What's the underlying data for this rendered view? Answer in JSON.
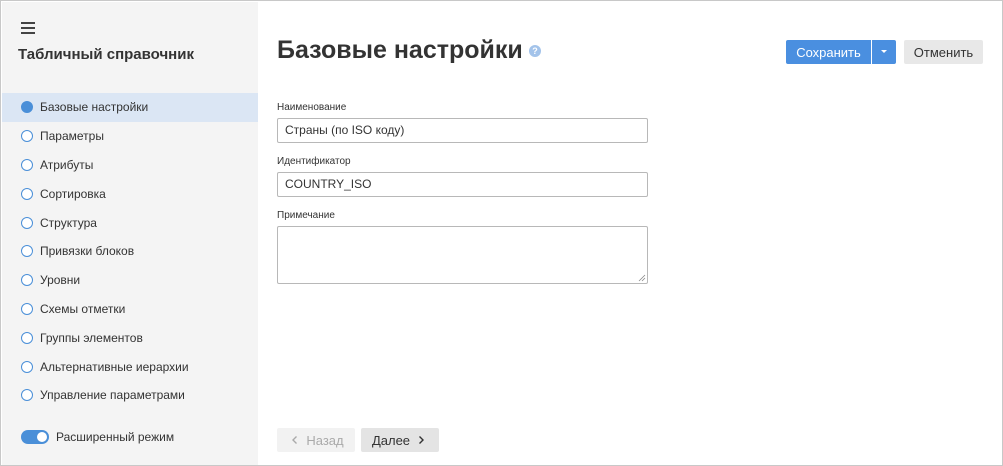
{
  "sidebar": {
    "title": "Табличный справочник",
    "items": [
      {
        "label": "Базовые настройки",
        "active": true
      },
      {
        "label": "Параметры",
        "active": false
      },
      {
        "label": "Атрибуты",
        "active": false
      },
      {
        "label": "Сортировка",
        "active": false
      },
      {
        "label": "Структура",
        "active": false
      },
      {
        "label": "Привязки блоков",
        "active": false
      },
      {
        "label": "Уровни",
        "active": false
      },
      {
        "label": "Схемы отметки",
        "active": false
      },
      {
        "label": "Группы элементов",
        "active": false
      },
      {
        "label": "Альтернативные иерархии",
        "active": false
      },
      {
        "label": "Управление параметрами",
        "active": false
      }
    ],
    "extended_mode_label": "Расширенный режим",
    "extended_mode_on": true
  },
  "header": {
    "title": "Базовые настройки",
    "help_glyph": "?",
    "save_label": "Сохранить",
    "cancel_label": "Отменить"
  },
  "form": {
    "name_label": "Наименование",
    "name_value": "Страны (по ISO коду)",
    "id_label": "Идентификатор",
    "id_value": "COUNTRY_ISO",
    "note_label": "Примечание",
    "note_value": ""
  },
  "footer": {
    "back_label": "Назад",
    "next_label": "Далее"
  },
  "colors": {
    "accent": "#4a8fe0",
    "active_item_bg": "#dbe6f4",
    "sidebar_bg": "#f4f4f4"
  },
  "icons": {
    "menu": "hamburger-icon",
    "help": "help-icon",
    "dropdown": "caret-down-icon",
    "back": "chevron-left-icon",
    "next": "chevron-right-icon"
  }
}
